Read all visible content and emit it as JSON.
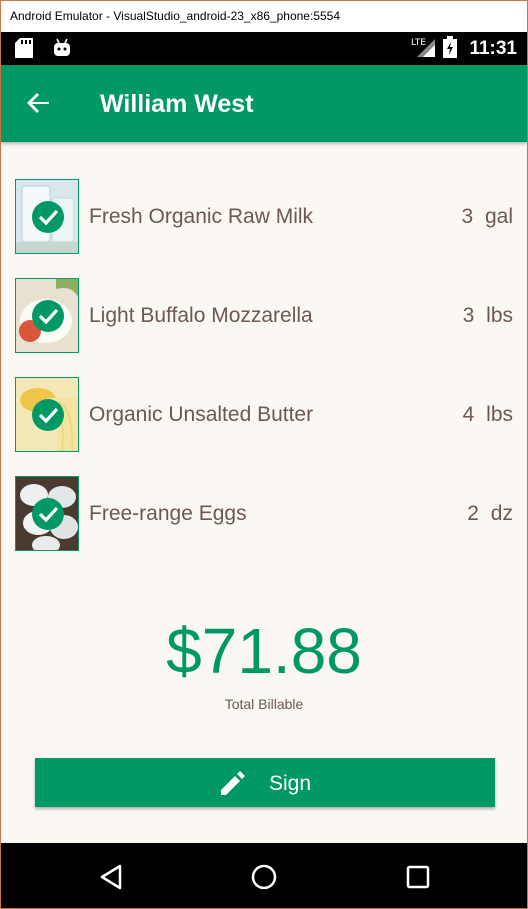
{
  "window": {
    "title": "Android Emulator - VisualStudio_android-23_x86_phone:5554"
  },
  "status_bar": {
    "time": "11:31",
    "network": "LTE"
  },
  "app_bar": {
    "title": "William West"
  },
  "items": [
    {
      "name": "Fresh Organic Raw Milk",
      "quantity": "3 gal",
      "checked": true
    },
    {
      "name": "Light Buffalo Mozzarella",
      "quantity": "3 lbs",
      "checked": true
    },
    {
      "name": "Organic Unsalted Butter",
      "quantity": "4 lbs",
      "checked": true
    },
    {
      "name": "Free-range Eggs",
      "quantity": "2 dz",
      "checked": true
    }
  ],
  "total": {
    "amount": "$71.88",
    "label": "Total Billable"
  },
  "sign_button": {
    "label": "Sign",
    "icon": "pencil-icon"
  },
  "nav_bar": {
    "back": "back-icon",
    "home": "home-icon",
    "recents": "recents-icon"
  },
  "colors": {
    "accent": "#009966",
    "background": "#fbf8f3",
    "text": "#6b5852"
  }
}
